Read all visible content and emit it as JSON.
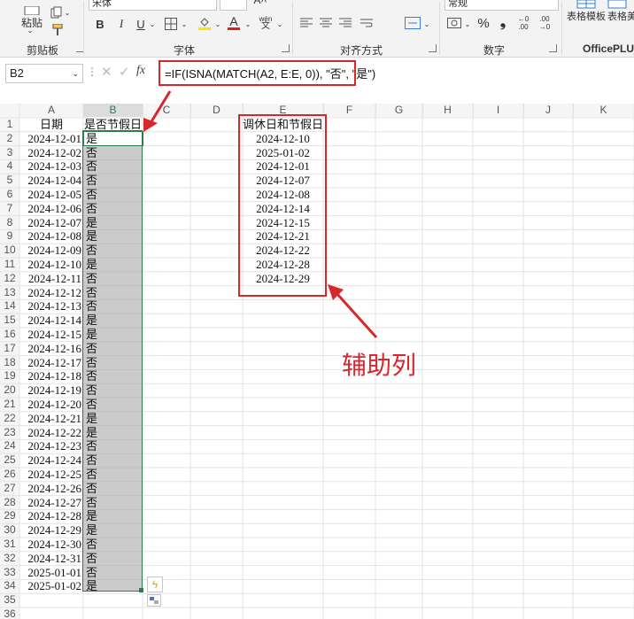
{
  "ribbon": {
    "paste_label": "粘贴",
    "clipboard_label": "剪贴板",
    "font_group_label": "字体",
    "align_group_label": "对齐方式",
    "number_group_label": "数字",
    "officeplus_label": "OfficePLUS",
    "template_label": "表格模板",
    "template2_label": "表格美",
    "font_name_value": "宋体",
    "number_format_value": "常规",
    "bold_label": "B",
    "italic_label": "I",
    "underline_label": "U",
    "percent_label": "%"
  },
  "formula_bar": {
    "name_box": "B2",
    "fx_label": "fx",
    "formula": "=IF(ISNA(MATCH(A2, E:E, 0)), \"否\", \"是\")"
  },
  "columns": [
    "A",
    "B",
    "C",
    "D",
    "E",
    "F",
    "G",
    "H",
    "I",
    "J",
    "K"
  ],
  "rows": [
    "1",
    "2",
    "3",
    "4",
    "5",
    "6",
    "7",
    "8",
    "9",
    "10",
    "11",
    "12",
    "13",
    "14",
    "15",
    "16",
    "17",
    "18",
    "19",
    "20",
    "21",
    "22",
    "23",
    "24",
    "25",
    "26",
    "27",
    "28",
    "29",
    "30",
    "31",
    "32",
    "33",
    "34",
    "35",
    "36"
  ],
  "sheet": {
    "header_a": "日期",
    "header_b": "是否节假日",
    "dates": [
      "2024-12-01",
      "2024-12-02",
      "2024-12-03",
      "2024-12-04",
      "2024-12-05",
      "2024-12-06",
      "2024-12-07",
      "2024-12-08",
      "2024-12-09",
      "2024-12-10",
      "2024-12-11",
      "2024-12-12",
      "2024-12-13",
      "2024-12-14",
      "2024-12-15",
      "2024-12-16",
      "2024-12-17",
      "2024-12-18",
      "2024-12-19",
      "2024-12-20",
      "2024-12-21",
      "2024-12-22",
      "2024-12-23",
      "2024-12-24",
      "2024-12-25",
      "2024-12-26",
      "2024-12-27",
      "2024-12-28",
      "2024-12-29",
      "2024-12-30",
      "2024-12-31",
      "2025-01-01",
      "2025-01-02"
    ],
    "holiday_flags": [
      "是",
      "否",
      "否",
      "否",
      "否",
      "否",
      "是",
      "是",
      "否",
      "是",
      "否",
      "否",
      "否",
      "是",
      "是",
      "否",
      "否",
      "否",
      "否",
      "否",
      "是",
      "是",
      "否",
      "否",
      "否",
      "否",
      "否",
      "是",
      "是",
      "否",
      "否",
      "否",
      "是"
    ],
    "helper_header": "调休日和节假日",
    "helper_dates": [
      "2024-12-10",
      "2025-01-02",
      "2024-12-01",
      "2024-12-07",
      "2024-12-08",
      "2024-12-14",
      "2024-12-15",
      "2024-12-21",
      "2024-12-22",
      "2024-12-28",
      "2024-12-29"
    ]
  },
  "annotation": {
    "helper_column_label": "辅助列",
    "accent_color": "#d9262c"
  }
}
